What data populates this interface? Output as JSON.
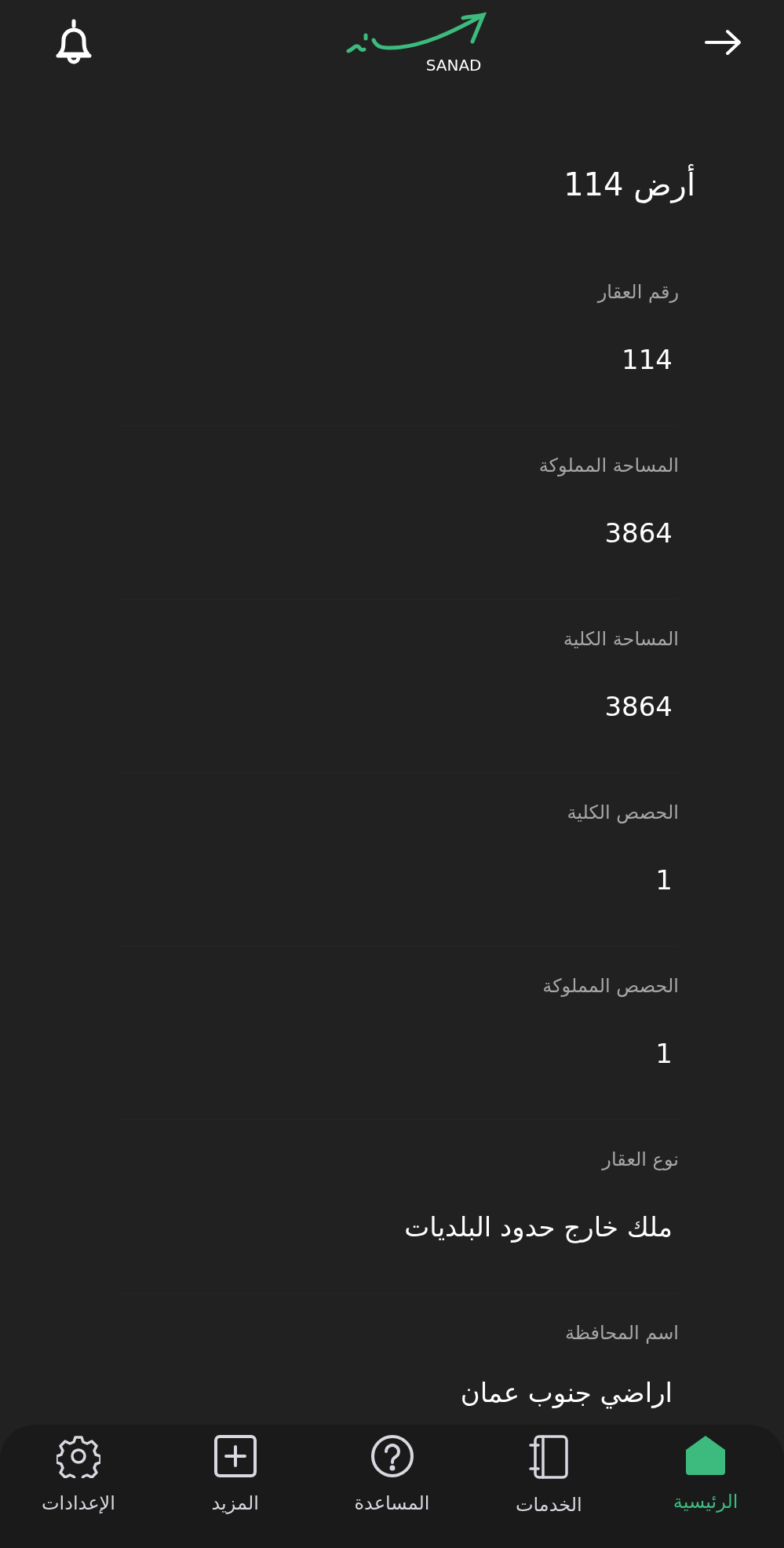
{
  "header": {
    "logo_text": "SANAD"
  },
  "title": "أرض 114",
  "fields": [
    {
      "label": "رقم العقار",
      "value": "114"
    },
    {
      "label": "المساحة المملوكة",
      "value": "3864"
    },
    {
      "label": "المساحة الكلية",
      "value": "3864"
    },
    {
      "label": "الحصص الكلية",
      "value": "1"
    },
    {
      "label": "الحصص المملوكة",
      "value": "1"
    },
    {
      "label": "نوع العقار",
      "value": "ملك خارج حدود البلديات"
    },
    {
      "label": "اسم المحافظة",
      "value": "اراضي جنوب عمان"
    }
  ],
  "nav": [
    {
      "kind": "home",
      "label": "الرئيسية",
      "selected": true
    },
    {
      "kind": "services",
      "label": "الخدمات",
      "selected": false
    },
    {
      "kind": "help",
      "label": "المساعدة",
      "selected": false
    },
    {
      "kind": "more",
      "label": "المزيد",
      "selected": false
    },
    {
      "kind": "settings",
      "label": "الإعدادات",
      "selected": false
    }
  ]
}
